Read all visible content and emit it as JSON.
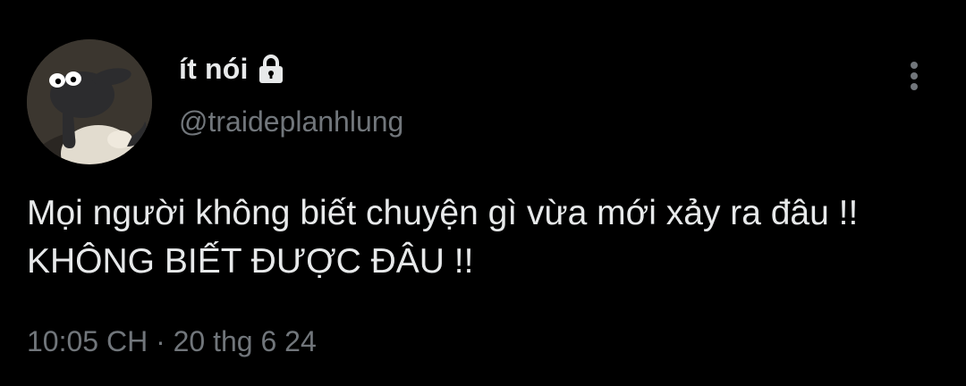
{
  "user": {
    "display_name": "ít nói",
    "handle": "@traideplanhlung",
    "avatar_icon": "sheep-avatar",
    "protected_icon": "lock-icon"
  },
  "tweet": {
    "text": "Mọi người không biết chuyện gì vừa mới xảy ra đâu !! KHÔNG BIẾT ĐƯỢC ĐÂU !!",
    "time": "10:05 CH",
    "separator": "·",
    "date": "20 thg 6 24"
  },
  "actions": {
    "more_icon": "more-vertical-icon"
  },
  "colors": {
    "background": "#000000",
    "text_primary": "#e7e9ea",
    "text_secondary": "#71767b"
  }
}
